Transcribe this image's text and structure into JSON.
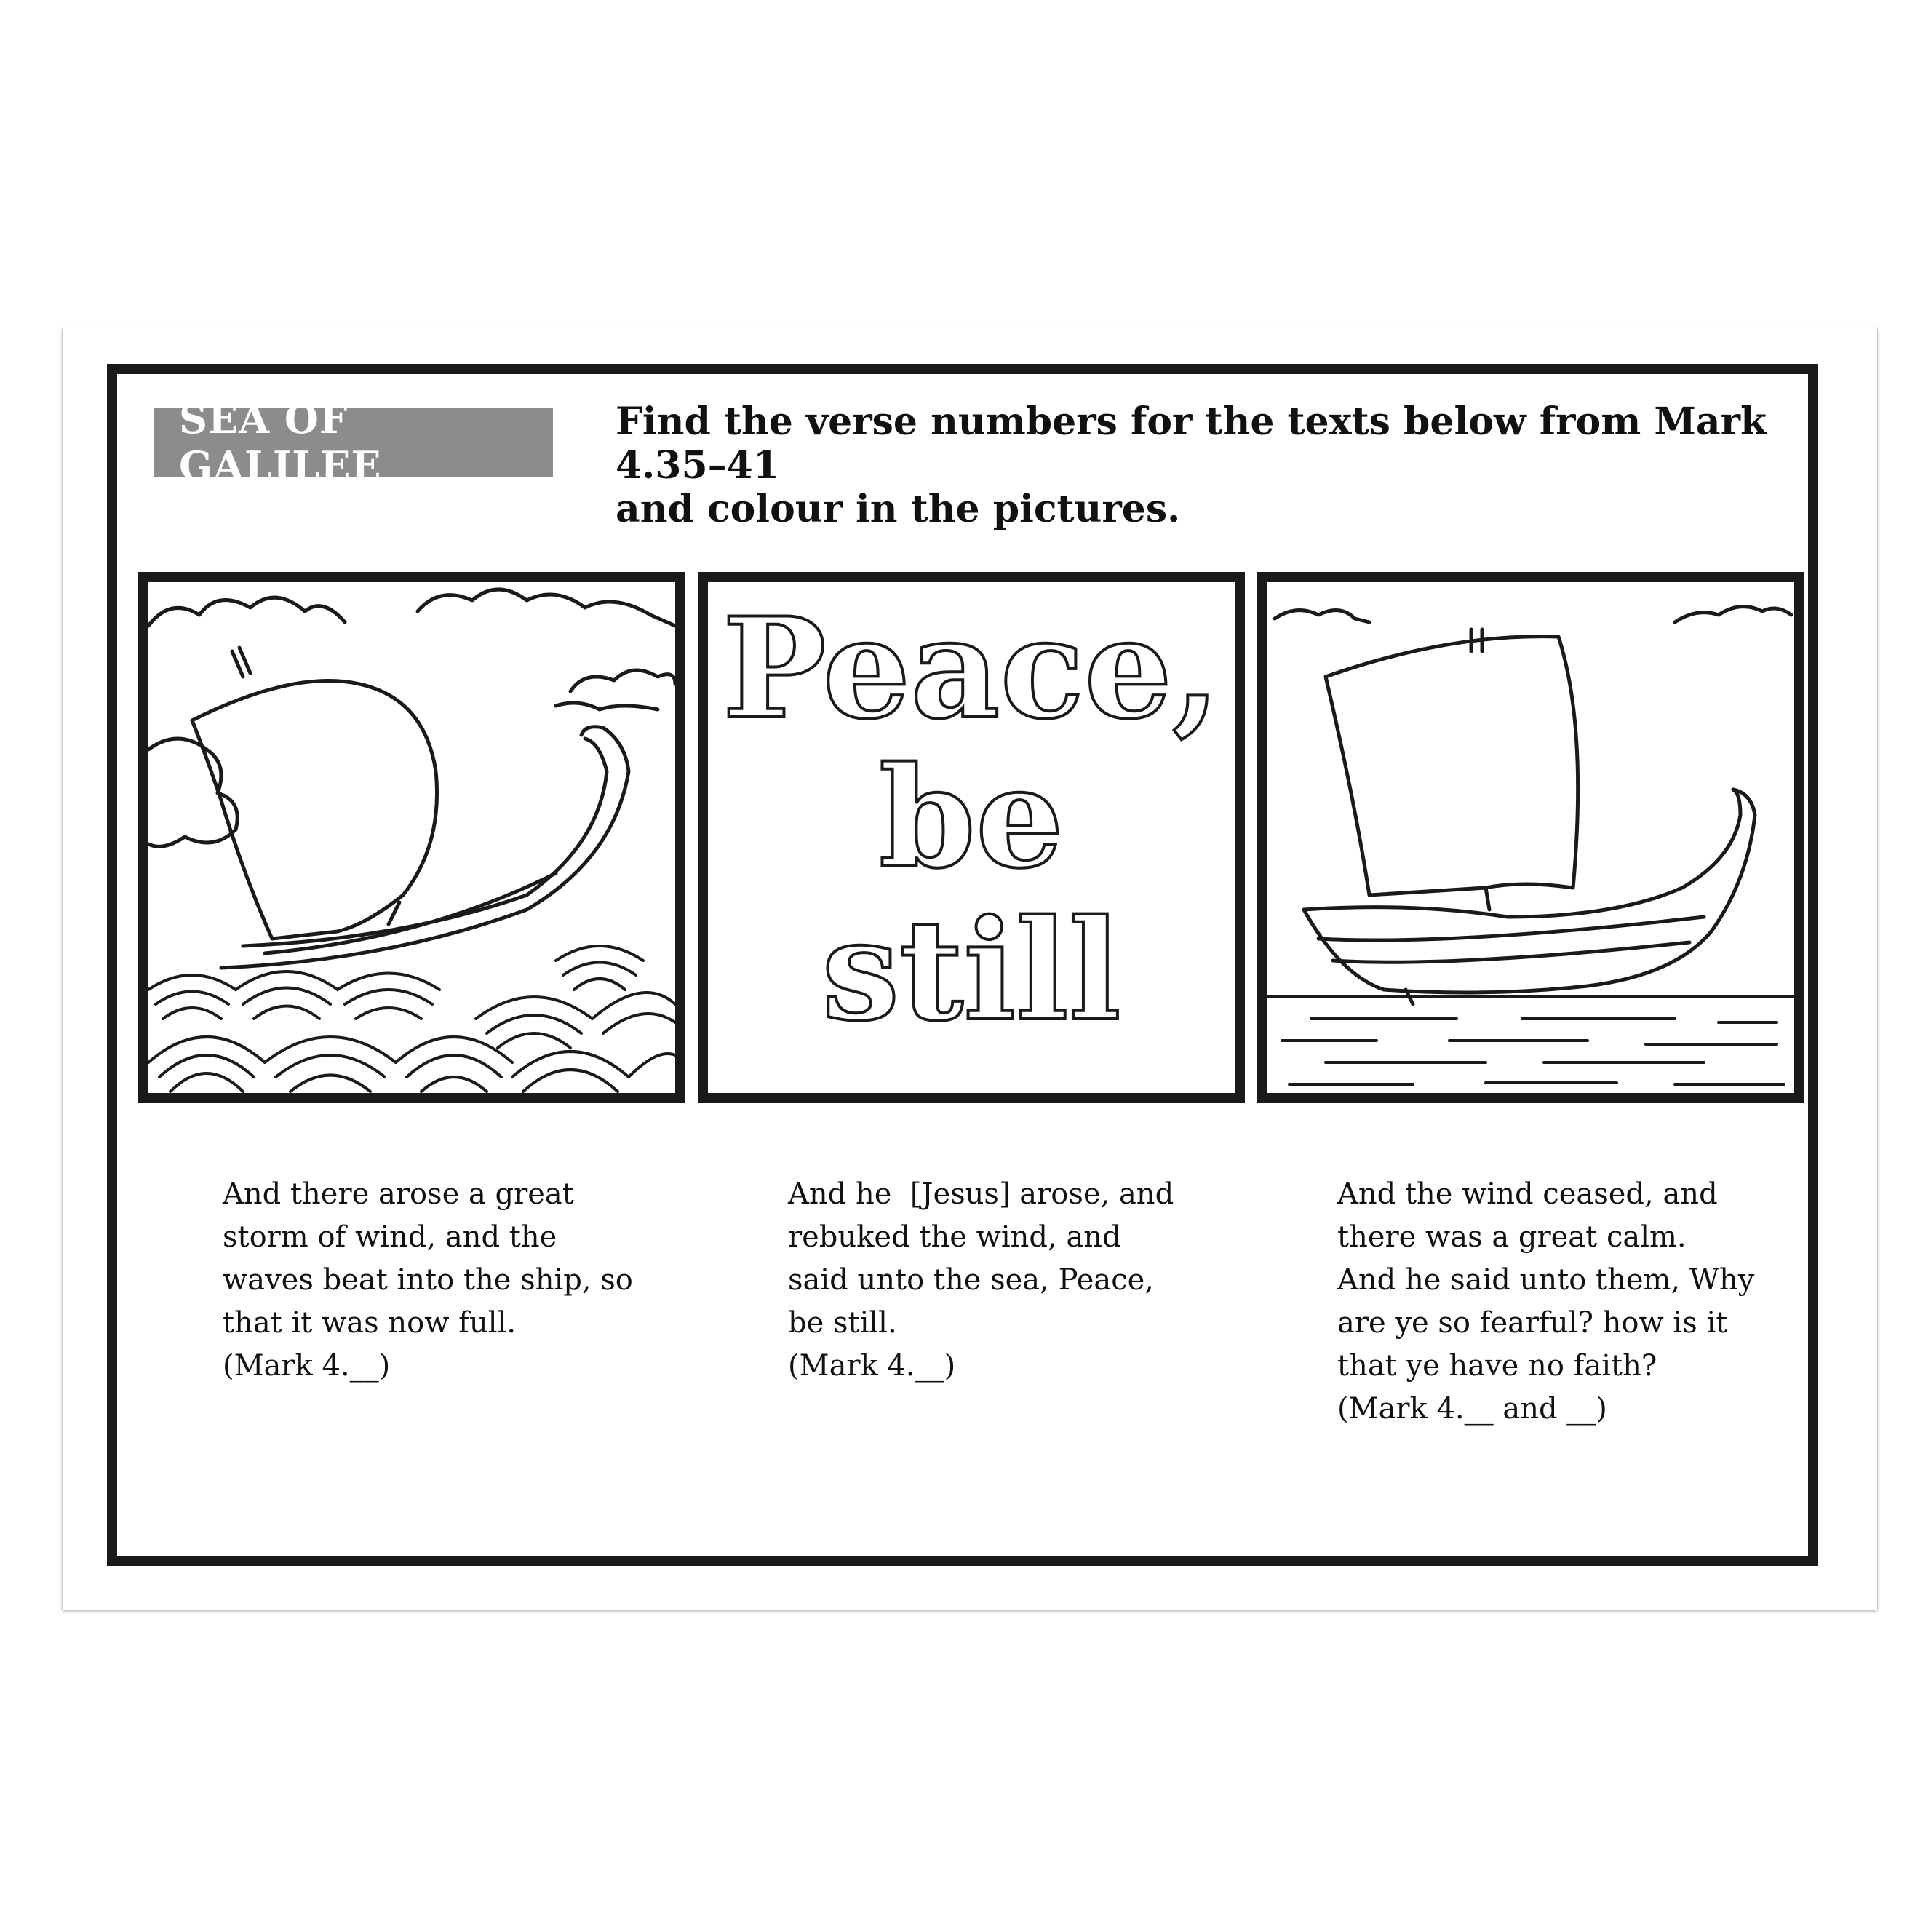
{
  "header": {
    "badge": "SEA OF GALILEE",
    "instruction_line1": "Find the verse numbers for the texts below from Mark 4.35–41",
    "instruction_line2": "and colour in the pictures."
  },
  "panels": {
    "middle_text": [
      "Peace,",
      "be",
      "still"
    ]
  },
  "captions": [
    {
      "lines": [
        "And there arose a great",
        "storm of wind, and the",
        "waves beat into the ship, so",
        "that it was now full.",
        "(Mark 4.__)"
      ]
    },
    {
      "lines": [
        "And he  [Jesus] arose, and",
        "rebuked the wind, and",
        "said unto the sea, Peace,",
        "be still.",
        "(Mark 4.__)"
      ]
    },
    {
      "lines": [
        "And the wind ceased, and",
        "there was a great calm.",
        "And he said unto them, Why",
        "are ye so fearful? how is it",
        "that ye have no faith?",
        "(Mark 4.__ and __)"
      ]
    }
  ],
  "colors": {
    "badge_bg": "#8c8c8c",
    "border": "#1a1a1a"
  }
}
